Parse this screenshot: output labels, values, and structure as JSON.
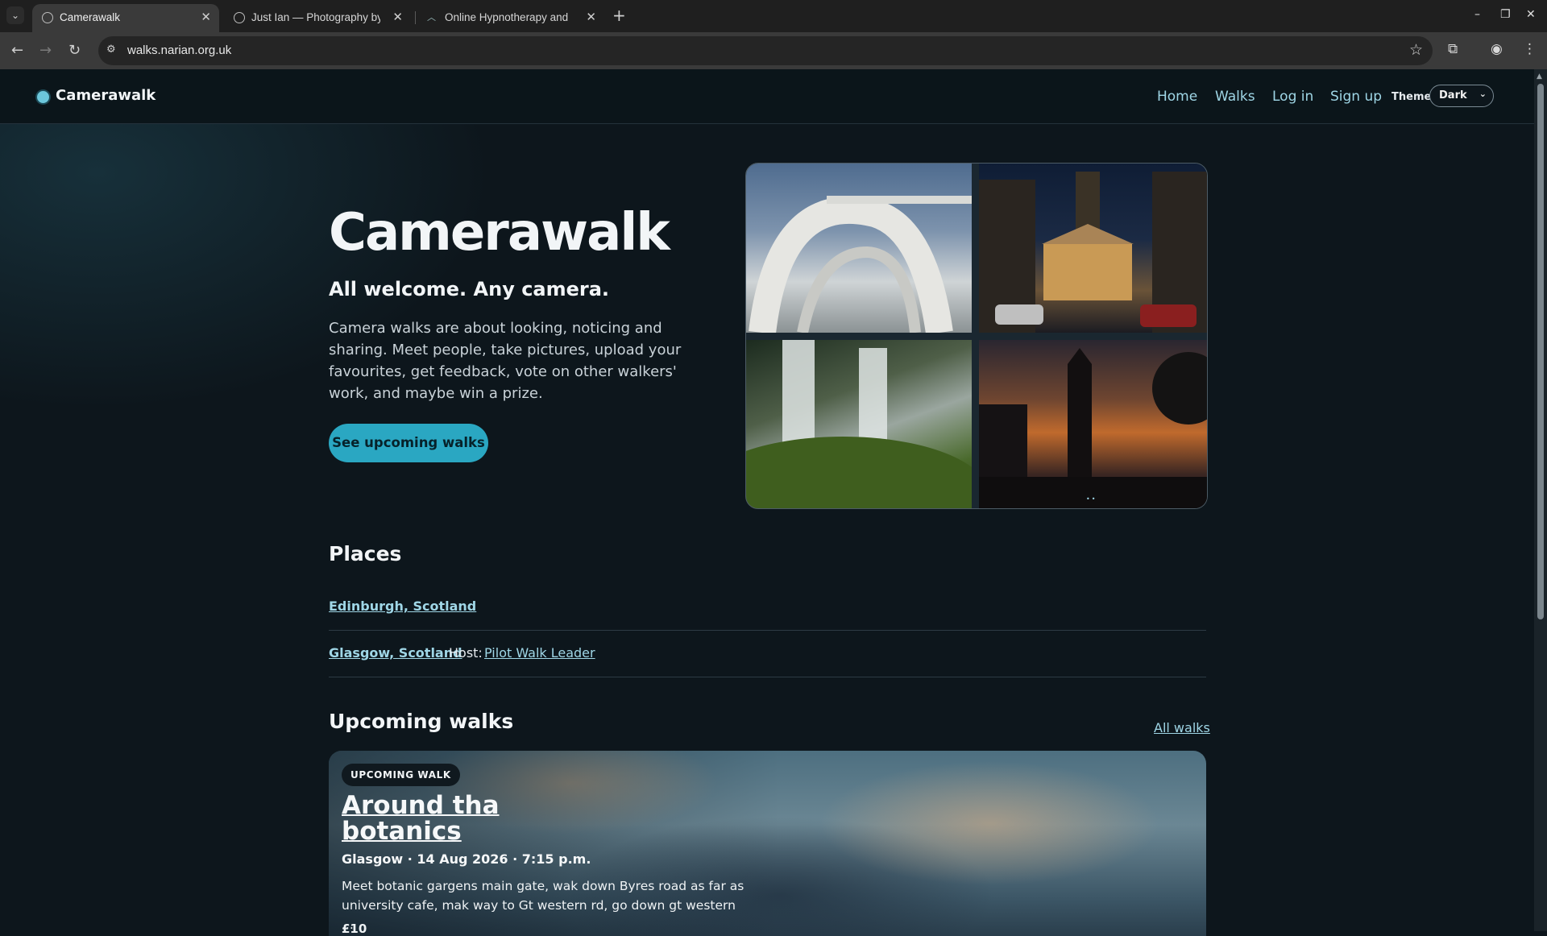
{
  "browser": {
    "tabs": [
      {
        "title": "Camerawalk",
        "active": true
      },
      {
        "title": "Just Ian — Photography by",
        "active": false
      },
      {
        "title": "Online Hypnotherapy and",
        "active": false
      }
    ],
    "url": "walks.narian.org.uk"
  },
  "site": {
    "brand": "Camerawalk",
    "nav": [
      "Home",
      "Walks",
      "Log in",
      "Sign up"
    ],
    "theme_label": "Theme",
    "theme_value": "Dark"
  },
  "hero": {
    "title": "Camerawalk",
    "subtitle": "All welcome. Any camera.",
    "text": "Camera walks are about looking, noticing and sharing. Meet people, take pictures, upload your favourites, get feedback, vote on other walkers' work, and maybe win a prize.",
    "cta": "See upcoming walks"
  },
  "places": {
    "heading": "Places",
    "items": [
      {
        "name": "Edinburgh, Scotland"
      },
      {
        "name": "Glasgow, Scotland",
        "host_label": "Host:",
        "host": "Pilot Walk Leader"
      }
    ]
  },
  "upcoming": {
    "heading": "Upcoming walks",
    "all_link": "All walks",
    "card": {
      "badge": "UPCOMING WALK",
      "title": "Around tha botanics",
      "meta": "Glasgow · 14 Aug 2026 · 7:15 p.m.",
      "description": "Meet botanic gargens main gate, wak down Byres road as far as university cafe, mak way to Gt western rd, go down gt western ...",
      "price": "£10"
    }
  },
  "colors": {
    "accent": "#2aa7c2",
    "link": "#9fd6e6",
    "background": "#0d161c"
  }
}
